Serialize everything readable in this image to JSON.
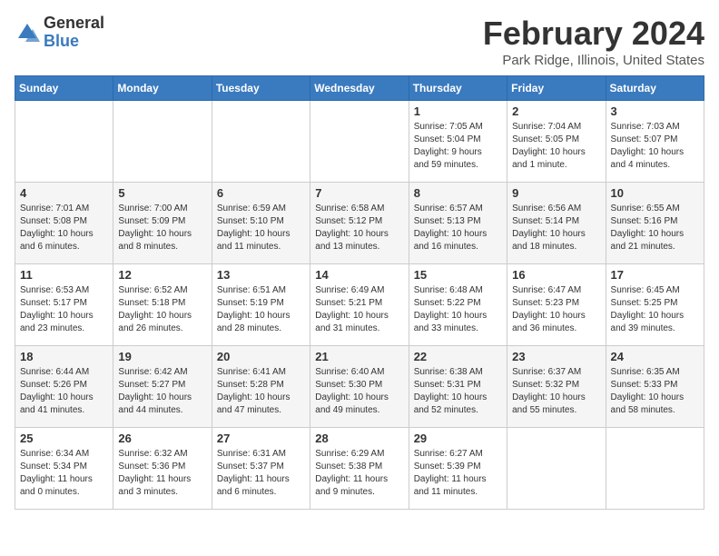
{
  "app": {
    "logo_general": "General",
    "logo_blue": "Blue"
  },
  "header": {
    "title": "February 2024",
    "subtitle": "Park Ridge, Illinois, United States"
  },
  "calendar": {
    "days_of_week": [
      "Sunday",
      "Monday",
      "Tuesday",
      "Wednesday",
      "Thursday",
      "Friday",
      "Saturday"
    ],
    "weeks": [
      [
        {
          "day": "",
          "info": ""
        },
        {
          "day": "",
          "info": ""
        },
        {
          "day": "",
          "info": ""
        },
        {
          "day": "",
          "info": ""
        },
        {
          "day": "1",
          "info": "Sunrise: 7:05 AM\nSunset: 5:04 PM\nDaylight: 9 hours\nand 59 minutes."
        },
        {
          "day": "2",
          "info": "Sunrise: 7:04 AM\nSunset: 5:05 PM\nDaylight: 10 hours\nand 1 minute."
        },
        {
          "day": "3",
          "info": "Sunrise: 7:03 AM\nSunset: 5:07 PM\nDaylight: 10 hours\nand 4 minutes."
        }
      ],
      [
        {
          "day": "4",
          "info": "Sunrise: 7:01 AM\nSunset: 5:08 PM\nDaylight: 10 hours\nand 6 minutes."
        },
        {
          "day": "5",
          "info": "Sunrise: 7:00 AM\nSunset: 5:09 PM\nDaylight: 10 hours\nand 8 minutes."
        },
        {
          "day": "6",
          "info": "Sunrise: 6:59 AM\nSunset: 5:10 PM\nDaylight: 10 hours\nand 11 minutes."
        },
        {
          "day": "7",
          "info": "Sunrise: 6:58 AM\nSunset: 5:12 PM\nDaylight: 10 hours\nand 13 minutes."
        },
        {
          "day": "8",
          "info": "Sunrise: 6:57 AM\nSunset: 5:13 PM\nDaylight: 10 hours\nand 16 minutes."
        },
        {
          "day": "9",
          "info": "Sunrise: 6:56 AM\nSunset: 5:14 PM\nDaylight: 10 hours\nand 18 minutes."
        },
        {
          "day": "10",
          "info": "Sunrise: 6:55 AM\nSunset: 5:16 PM\nDaylight: 10 hours\nand 21 minutes."
        }
      ],
      [
        {
          "day": "11",
          "info": "Sunrise: 6:53 AM\nSunset: 5:17 PM\nDaylight: 10 hours\nand 23 minutes."
        },
        {
          "day": "12",
          "info": "Sunrise: 6:52 AM\nSunset: 5:18 PM\nDaylight: 10 hours\nand 26 minutes."
        },
        {
          "day": "13",
          "info": "Sunrise: 6:51 AM\nSunset: 5:19 PM\nDaylight: 10 hours\nand 28 minutes."
        },
        {
          "day": "14",
          "info": "Sunrise: 6:49 AM\nSunset: 5:21 PM\nDaylight: 10 hours\nand 31 minutes."
        },
        {
          "day": "15",
          "info": "Sunrise: 6:48 AM\nSunset: 5:22 PM\nDaylight: 10 hours\nand 33 minutes."
        },
        {
          "day": "16",
          "info": "Sunrise: 6:47 AM\nSunset: 5:23 PM\nDaylight: 10 hours\nand 36 minutes."
        },
        {
          "day": "17",
          "info": "Sunrise: 6:45 AM\nSunset: 5:25 PM\nDaylight: 10 hours\nand 39 minutes."
        }
      ],
      [
        {
          "day": "18",
          "info": "Sunrise: 6:44 AM\nSunset: 5:26 PM\nDaylight: 10 hours\nand 41 minutes."
        },
        {
          "day": "19",
          "info": "Sunrise: 6:42 AM\nSunset: 5:27 PM\nDaylight: 10 hours\nand 44 minutes."
        },
        {
          "day": "20",
          "info": "Sunrise: 6:41 AM\nSunset: 5:28 PM\nDaylight: 10 hours\nand 47 minutes."
        },
        {
          "day": "21",
          "info": "Sunrise: 6:40 AM\nSunset: 5:30 PM\nDaylight: 10 hours\nand 49 minutes."
        },
        {
          "day": "22",
          "info": "Sunrise: 6:38 AM\nSunset: 5:31 PM\nDaylight: 10 hours\nand 52 minutes."
        },
        {
          "day": "23",
          "info": "Sunrise: 6:37 AM\nSunset: 5:32 PM\nDaylight: 10 hours\nand 55 minutes."
        },
        {
          "day": "24",
          "info": "Sunrise: 6:35 AM\nSunset: 5:33 PM\nDaylight: 10 hours\nand 58 minutes."
        }
      ],
      [
        {
          "day": "25",
          "info": "Sunrise: 6:34 AM\nSunset: 5:34 PM\nDaylight: 11 hours\nand 0 minutes."
        },
        {
          "day": "26",
          "info": "Sunrise: 6:32 AM\nSunset: 5:36 PM\nDaylight: 11 hours\nand 3 minutes."
        },
        {
          "day": "27",
          "info": "Sunrise: 6:31 AM\nSunset: 5:37 PM\nDaylight: 11 hours\nand 6 minutes."
        },
        {
          "day": "28",
          "info": "Sunrise: 6:29 AM\nSunset: 5:38 PM\nDaylight: 11 hours\nand 9 minutes."
        },
        {
          "day": "29",
          "info": "Sunrise: 6:27 AM\nSunset: 5:39 PM\nDaylight: 11 hours\nand 11 minutes."
        },
        {
          "day": "",
          "info": ""
        },
        {
          "day": "",
          "info": ""
        }
      ]
    ]
  }
}
